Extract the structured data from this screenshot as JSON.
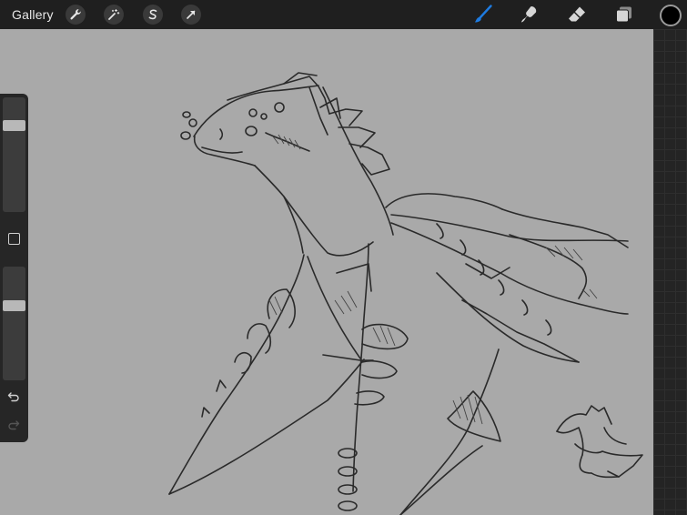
{
  "topbar": {
    "gallery_label": "Gallery",
    "left_tools": [
      "wrench-icon",
      "magic-wand-icon",
      "selection-s-icon",
      "transform-arrow-icon"
    ],
    "right_tools": [
      "brush-icon",
      "smudge-icon",
      "eraser-icon",
      "layers-icon"
    ],
    "active_tool": "brush-icon",
    "accent_color": "#1e7be0",
    "current_color": "#000000"
  },
  "sidebar": {
    "brush_size_level": 0.78,
    "opacity_level": 0.67,
    "buttons": [
      "modify-square-icon",
      "undo-icon",
      "redo-icon"
    ]
  },
  "canvas": {
    "background_color": "#a9a9a9",
    "content": "dragon-sketch"
  }
}
